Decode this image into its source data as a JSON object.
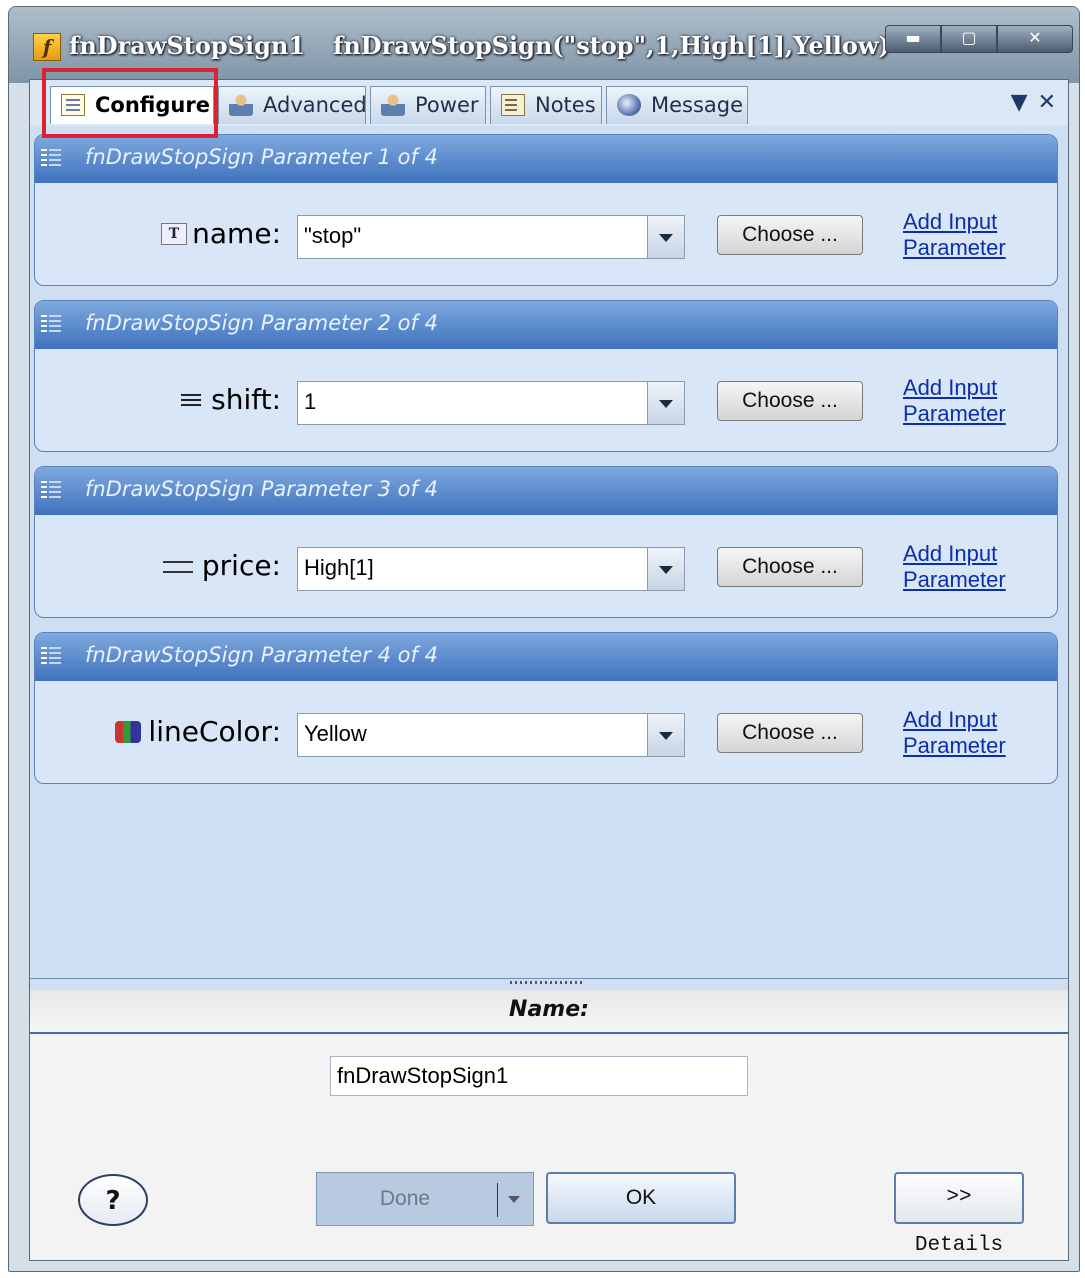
{
  "window": {
    "name": "fnDrawStopSign1",
    "expression": "fnDrawStopSign(\"stop\",1,High[1],Yellow)",
    "icon": "function-icon"
  },
  "tabs": [
    {
      "label": "Configure",
      "icon": "configure-icon",
      "active": true
    },
    {
      "label": "Advanced",
      "icon": "advanced-icon"
    },
    {
      "label": "Power",
      "icon": "power-icon"
    },
    {
      "label": "Notes",
      "icon": "notes-icon"
    },
    {
      "label": "Message",
      "icon": "message-icon"
    }
  ],
  "parameters": [
    {
      "title": "fnDrawStopSign Parameter 1 of 4",
      "label": "name:",
      "value": "\"stop\"",
      "choose": "Choose ...",
      "link1": "Add Input",
      "link2": "Parameter"
    },
    {
      "title": "fnDrawStopSign Parameter 2 of 4",
      "label": "shift:",
      "value": "1",
      "choose": "Choose ...",
      "link1": "Add Input",
      "link2": "Parameter"
    },
    {
      "title": "fnDrawStopSign Parameter 3 of 4",
      "label": "price:",
      "value": "High[1]",
      "choose": "Choose ...",
      "link1": "Add Input",
      "link2": "Parameter"
    },
    {
      "title": "fnDrawStopSign Parameter 4 of 4",
      "label": "lineColor:",
      "value": "Yellow",
      "choose": "Choose ...",
      "link1": "Add Input",
      "link2": "Parameter"
    }
  ],
  "name_section": {
    "header": "Name:",
    "value": "fnDrawStopSign1"
  },
  "buttons": {
    "help": "?",
    "done": "Done",
    "ok": "OK",
    "details": ">> Details"
  }
}
